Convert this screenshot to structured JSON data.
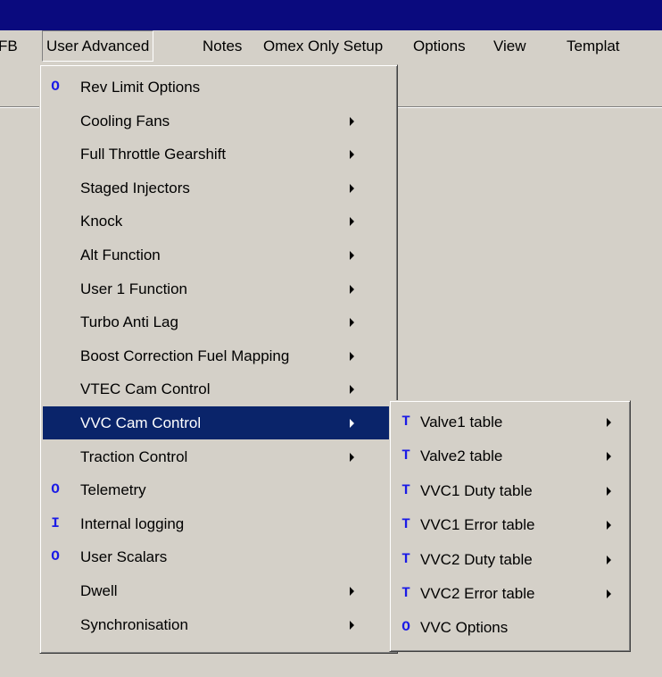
{
  "menubar": {
    "items": [
      {
        "label": "FB"
      },
      {
        "label": "User Advanced"
      },
      {
        "label": "Notes"
      },
      {
        "label": "Omex Only Setup"
      },
      {
        "label": "Options"
      },
      {
        "label": "View"
      },
      {
        "label": "Templat"
      }
    ]
  },
  "user_advanced_menu": {
    "items": [
      {
        "mark": "O",
        "label": "Rev Limit Options"
      },
      {
        "mark": "",
        "label": "Cooling Fans",
        "submenu": true
      },
      {
        "mark": "",
        "label": "Full Throttle Gearshift",
        "submenu": true
      },
      {
        "mark": "",
        "label": "Staged Injectors",
        "submenu": true
      },
      {
        "mark": "",
        "label": "Knock",
        "submenu": true
      },
      {
        "mark": "",
        "label": "Alt Function",
        "submenu": true
      },
      {
        "mark": "",
        "label": "User 1 Function",
        "submenu": true
      },
      {
        "mark": "",
        "label": "Turbo Anti Lag",
        "submenu": true
      },
      {
        "mark": "",
        "label": "Boost Correction Fuel Mapping",
        "submenu": true
      },
      {
        "mark": "",
        "label": "VTEC Cam Control",
        "submenu": true
      },
      {
        "mark": "",
        "label": "VVC Cam Control",
        "submenu": true,
        "highlighted": true
      },
      {
        "mark": "",
        "label": "Traction Control",
        "submenu": true
      },
      {
        "mark": "O",
        "label": "Telemetry"
      },
      {
        "mark": "I",
        "label": "Internal logging"
      },
      {
        "mark": "O",
        "label": "User Scalars"
      },
      {
        "mark": "",
        "label": "Dwell",
        "submenu": true
      },
      {
        "mark": "",
        "label": "Synchronisation",
        "submenu": true
      }
    ]
  },
  "vvc_submenu": {
    "items": [
      {
        "mark": "T",
        "label": "Valve1 table",
        "submenu": true
      },
      {
        "mark": "T",
        "label": "Valve2 table",
        "submenu": true
      },
      {
        "mark": "T",
        "label": "VVC1 Duty table",
        "submenu": true
      },
      {
        "mark": "T",
        "label": "VVC1 Error table",
        "submenu": true
      },
      {
        "mark": "T",
        "label": "VVC2 Duty table",
        "submenu": true
      },
      {
        "mark": "T",
        "label": "VVC2 Error table",
        "submenu": true
      },
      {
        "mark": "O",
        "label": "VVC Options"
      }
    ]
  },
  "colors": {
    "titlebar": "#0a0a7e",
    "highlight": "#0a246a",
    "mark": "#1a1ae6",
    "face": "#d4d0c8"
  }
}
